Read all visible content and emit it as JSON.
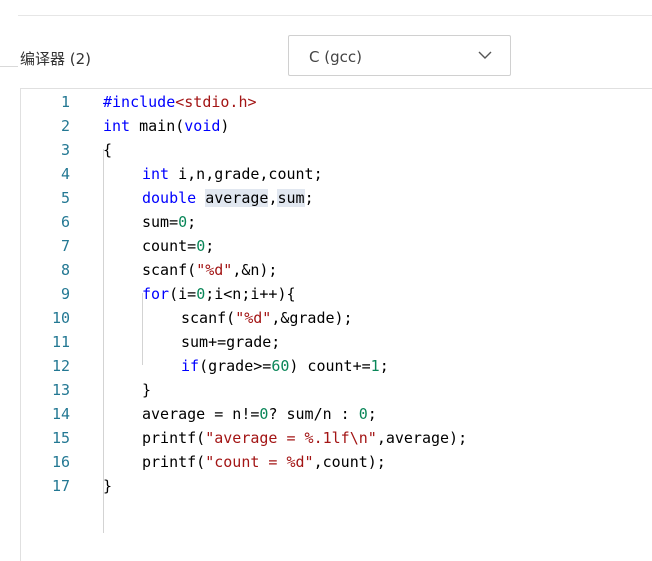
{
  "header": {
    "compiler_label": "编译器 (2)",
    "compiler_select": {
      "value": "C (gcc)",
      "icon": "chevron-down-icon"
    }
  },
  "editor": {
    "colors": {
      "keyword": "#0000ff",
      "string": "#a31515",
      "number": "#098658",
      "line_number": "#237893",
      "plain": "#000000"
    },
    "lines": [
      {
        "n": "1",
        "indent": 0,
        "tokens": [
          [
            "kw",
            "#include"
          ],
          [
            "str",
            "<stdio.h>"
          ]
        ]
      },
      {
        "n": "2",
        "indent": 0,
        "tokens": [
          [
            "kw",
            "int"
          ],
          [
            "",
            " main("
          ],
          [
            "kw",
            "void"
          ],
          [
            "",
            ")"
          ]
        ]
      },
      {
        "n": "3",
        "indent": 0,
        "tokens": [
          [
            "",
            "{"
          ]
        ]
      },
      {
        "n": "4",
        "indent": 1,
        "tokens": [
          [
            "kw",
            "int"
          ],
          [
            "",
            " i,n,grade,count;"
          ]
        ]
      },
      {
        "n": "5",
        "indent": 1,
        "tokens": [
          [
            "kw",
            "double"
          ],
          [
            "",
            " "
          ],
          [
            "hl",
            "average"
          ],
          [
            "",
            ","
          ],
          [
            "hl",
            "sum"
          ],
          [
            "",
            ";"
          ]
        ]
      },
      {
        "n": "6",
        "indent": 1,
        "tokens": [
          [
            "",
            "sum="
          ],
          [
            "num",
            "0"
          ],
          [
            "",
            ";"
          ]
        ]
      },
      {
        "n": "7",
        "indent": 1,
        "tokens": [
          [
            "",
            "count="
          ],
          [
            "num",
            "0"
          ],
          [
            "",
            ";"
          ]
        ]
      },
      {
        "n": "8",
        "indent": 1,
        "tokens": [
          [
            "",
            "scanf("
          ],
          [
            "str",
            "\"%d\""
          ],
          [
            "",
            ",&n);"
          ]
        ]
      },
      {
        "n": "9",
        "indent": 1,
        "tokens": [
          [
            "kw",
            "for"
          ],
          [
            "",
            "(i="
          ],
          [
            "num",
            "0"
          ],
          [
            "",
            ";i<n;i++){"
          ]
        ]
      },
      {
        "n": "10",
        "indent": 2,
        "tokens": [
          [
            "",
            "scanf("
          ],
          [
            "str",
            "\"%d\""
          ],
          [
            "",
            ",&grade);"
          ]
        ]
      },
      {
        "n": "11",
        "indent": 2,
        "tokens": [
          [
            "",
            "sum+=grade;"
          ]
        ]
      },
      {
        "n": "12",
        "indent": 2,
        "tokens": [
          [
            "kw",
            "if"
          ],
          [
            "",
            "(grade>="
          ],
          [
            "num",
            "60"
          ],
          [
            "",
            ") count+="
          ],
          [
            "num",
            "1"
          ],
          [
            "",
            ";"
          ]
        ]
      },
      {
        "n": "13",
        "indent": 1,
        "tokens": [
          [
            "",
            "}"
          ]
        ]
      },
      {
        "n": "14",
        "indent": 1,
        "tokens": [
          [
            "",
            "average = n!="
          ],
          [
            "num",
            "0"
          ],
          [
            "",
            "? sum/n : "
          ],
          [
            "num",
            "0"
          ],
          [
            "",
            ";"
          ]
        ]
      },
      {
        "n": "15",
        "indent": 1,
        "tokens": [
          [
            "",
            "printf("
          ],
          [
            "str",
            "\"average = %.1lf\\n\""
          ],
          [
            "",
            ",average);"
          ]
        ]
      },
      {
        "n": "16",
        "indent": 1,
        "tokens": [
          [
            "",
            "printf("
          ],
          [
            "str",
            "\"count = %d\""
          ],
          [
            "",
            ",count);"
          ]
        ]
      },
      {
        "n": "17",
        "indent": 0,
        "tokens": [
          [
            "",
            "}"
          ]
        ]
      }
    ]
  }
}
